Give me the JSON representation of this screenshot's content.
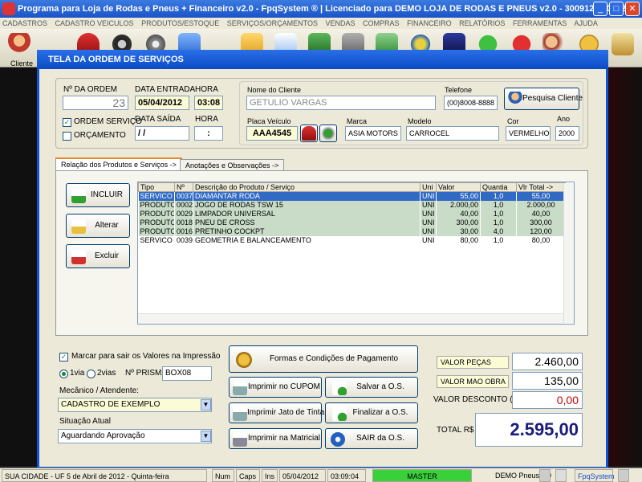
{
  "window": {
    "title": "Programa para Loja de Rodas e Pneus + Financeiro v2.0 - FpqSystem ® | Licenciado para  DEMO LOJA DE RODAS E PNEUS v2.0 - 300912 010412",
    "min": "_",
    "max": "□",
    "close": "✕"
  },
  "menu": [
    "CADASTROS",
    "CADASTRO VEICULOS",
    "PRODUTOS/ESTOQUE",
    "SERVIÇOS/ORÇAMENTOS",
    "VENDAS",
    "COMPRAS",
    "FINANCEIRO",
    "RELATÓRIOS",
    "FERRAMENTAS",
    "AJUDA"
  ],
  "toolbar": {
    "cliente_label": "Cliente",
    "icons": [
      "user-icon",
      "car-icon",
      "tire-icon",
      "wheel-icon",
      "box-icon",
      "folder-icon",
      "envelope-icon",
      "truck-icon",
      "cash-register-icon",
      "money-icon",
      "globe-icon",
      "laptop-icon",
      "dollar-icon",
      "dollar-icon",
      "people-icon",
      "coin-icon",
      "exit-icon"
    ]
  },
  "dialog": {
    "title": "TELA DA ORDEM DE SERVIÇOS"
  },
  "order": {
    "numero_label": "Nº DA ORDEM",
    "numero": "23",
    "data_entrada_label": "DATA ENTRADA",
    "data_entrada": "05/04/2012",
    "hora_label": "HORA",
    "hora": "03:08",
    "ordem_servico_label": "ORDEM SERVIÇO",
    "orcamento_label": "ORÇAMENTO",
    "data_saida_label": "DATA SAÍDA",
    "data_saida": " / /",
    "hora_saida_label": "HORA",
    "hora_saida": ":"
  },
  "cliente": {
    "nome_label": "Nome do Cliente",
    "nome": "GETULIO VARGAS",
    "telefone_label": "Telefone",
    "telefone": "(00)8008-8888",
    "pesquisa_button": "Pesquisa Cliente",
    "placa_label": "Placa Veículo",
    "placa": "AAA4545",
    "marca_label": "Marca",
    "marca": "ASIA MOTORS",
    "modelo_label": "Modelo",
    "modelo": "CARROCEL",
    "cor_label": "Cor",
    "cor": "VERMELHO",
    "ano_label": "Ano",
    "ano": "2000"
  },
  "tabs": [
    "Relação dos Produtos e Serviços ->",
    "Anotações e Observações ->"
  ],
  "actions": {
    "incluir": "INCLUIR",
    "alterar": "Alterar",
    "excluir": "Excluir"
  },
  "grid": {
    "columns": [
      "Tipo",
      "Nº",
      "Descrição do Produto / Serviço",
      "Uni",
      "Valor",
      "Quantia",
      "Vlr Total ->"
    ],
    "rows": [
      [
        "SERVICO",
        "0037",
        "DIAMANTAR RODA",
        "UNI",
        "55,00",
        "1,0",
        "55,00"
      ],
      [
        "PRODUTO",
        "0002",
        "JOGO DE RODAS TSW 15",
        "UNI",
        "2.000,00",
        "1,0",
        "2.000,00"
      ],
      [
        "PRODUTO",
        "0029",
        "LIMPADOR UNIVERSAL",
        "UNI",
        "40,00",
        "1,0",
        "40,00"
      ],
      [
        "PRODUTO",
        "0018",
        "PNEU DE CROSS",
        "UNI",
        "300,00",
        "1,0",
        "300,00"
      ],
      [
        "PRODUTO",
        "0016",
        "PRETINHO COCKPT",
        "UNI",
        "30,00",
        "4,0",
        "120,00"
      ],
      [
        "SERVICO",
        "0039",
        "GEOMETRIA E BALANCEAMENTO",
        "UNI",
        "80,00",
        "1,0",
        "80,00"
      ]
    ]
  },
  "print": {
    "marcar_label": "Marcar para sair os Valores na Impressão",
    "via1": "1via",
    "via2": "2vias",
    "prisma_label": "Nº PRISMA",
    "prisma": "BOX08",
    "mecanico_label": "Mecânico / Atendente:",
    "mecanico": "CADASTRO DE EXEMPLO",
    "situacao_label": "Situação Atual",
    "situacao": "Aguardando Aprovação"
  },
  "buttons": {
    "formas": "Formas e Condições de Pagamento",
    "cupom": "Imprimir no CUPOM",
    "jato": "Imprimir Jato de Tinta",
    "matricial": "Imprimir na Matricial",
    "salvar": "Salvar a O.S.",
    "finalizar": "Finalizar a O.S.",
    "sair": "SAIR da O.S."
  },
  "totals": {
    "pecas_label": "VALOR PEÇAS",
    "pecas": "2.460,00",
    "mao_obra_label": "VALOR MAO OBRA",
    "mao_obra": "135,00",
    "desconto_label": "VALOR DESCONTO ( - )",
    "desconto": "0,00",
    "total_label": "TOTAL R$",
    "total": "2.595,00"
  },
  "status": {
    "cidade": "SUA CIDADE - UF  5 de Abril de 2012 - Quinta-feira",
    "num": "Num",
    "caps": "Caps",
    "ins": "Ins",
    "date": "05/04/2012",
    "time": "03:09:04",
    "user": "MASTER",
    "version": "DEMO Pneus 2.0",
    "brand": "FpqSystem"
  },
  "colors": {
    "title_blue": "#0a4cc6",
    "total_blue": "#1a1a7a",
    "desconto_red": "#cc0000",
    "selected_row": "#316ac5",
    "row_green": "#c8dcc8"
  }
}
